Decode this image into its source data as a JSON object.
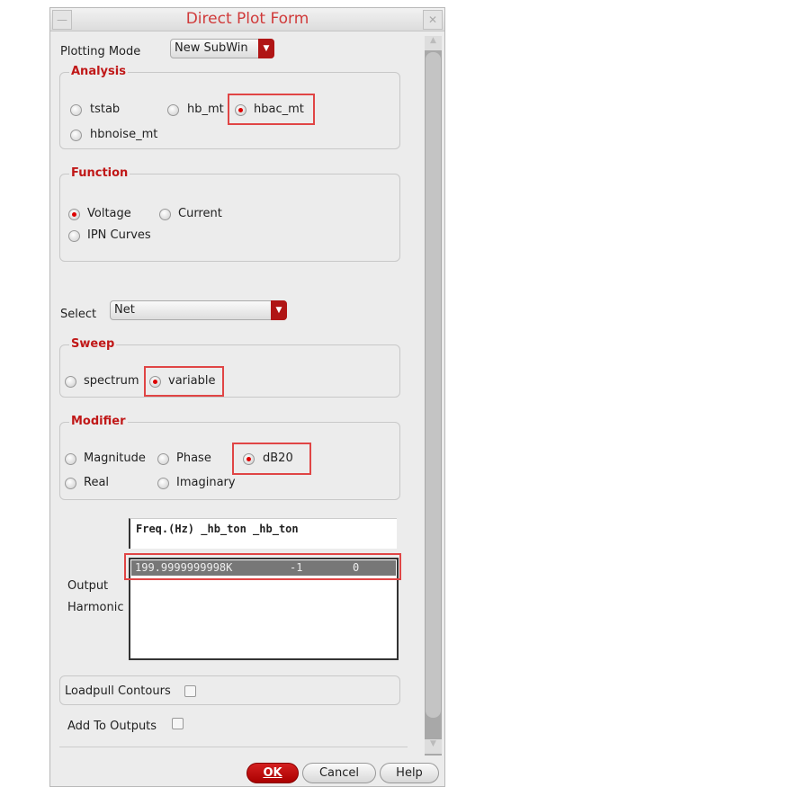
{
  "window": {
    "title": "Direct Plot Form"
  },
  "plotting_mode": {
    "label": "Plotting Mode",
    "value": "New SubWin"
  },
  "analysis": {
    "legend": "Analysis",
    "options": [
      {
        "label": "tstab",
        "selected": false
      },
      {
        "label": "hb_mt",
        "selected": false
      },
      {
        "label": "hbac_mt",
        "selected": true
      },
      {
        "label": "hbnoise_mt",
        "selected": false
      }
    ]
  },
  "function": {
    "legend": "Function",
    "options": [
      {
        "label": "Voltage",
        "selected": true
      },
      {
        "label": "Current",
        "selected": false
      },
      {
        "label": "IPN Curves",
        "selected": false
      }
    ]
  },
  "select": {
    "label": "Select",
    "value": "Net"
  },
  "sweep": {
    "legend": "Sweep",
    "options": [
      {
        "label": "spectrum",
        "selected": false
      },
      {
        "label": "variable",
        "selected": true
      }
    ]
  },
  "modifier": {
    "legend": "Modifier",
    "options": [
      {
        "label": "Magnitude",
        "selected": false
      },
      {
        "label": "Phase",
        "selected": false
      },
      {
        "label": "dB20",
        "selected": true
      },
      {
        "label": "Real",
        "selected": false
      },
      {
        "label": "Imaginary",
        "selected": false
      }
    ]
  },
  "output_harmonic": {
    "label_line1": "Output",
    "label_line2": "Harmonic",
    "header": "Freq.(Hz) _hb_ton _hb_ton",
    "rows": [
      {
        "freq": "199.9999999998K",
        "h1": "-1",
        "h2": "0",
        "selected": true
      }
    ]
  },
  "loadpull": {
    "label": "Loadpull Contours",
    "checked": false
  },
  "add_to_outputs": {
    "label": "Add To Outputs",
    "checked": false
  },
  "buttons": {
    "ok": "OK",
    "cancel": "Cancel",
    "help": "Help"
  }
}
